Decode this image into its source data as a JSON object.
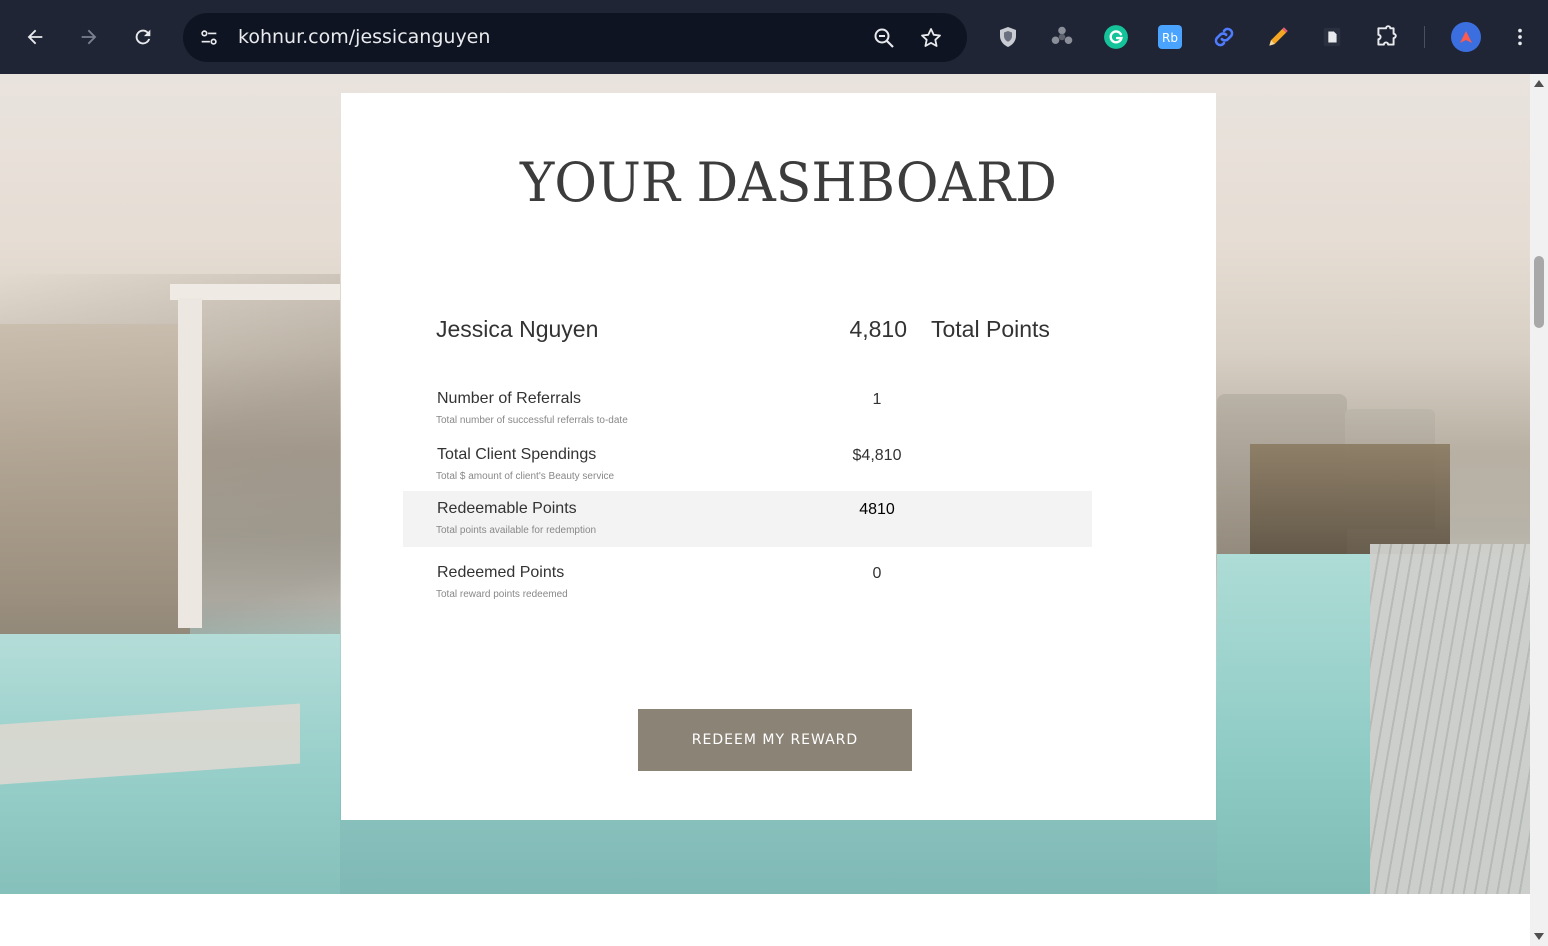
{
  "browser": {
    "url": "kohnur.com/jessicanguyen",
    "icons": {
      "back": "arrow-left-icon",
      "forward": "arrow-right-icon",
      "reload": "reload-icon",
      "site_info": "tune-icon",
      "zoom": "zoom-out-icon",
      "bookmark": "star-icon",
      "menu": "kebab-menu-icon"
    },
    "extensions": [
      {
        "name": "shield-extension-icon"
      },
      {
        "name": "cloud-extension-icon"
      },
      {
        "name": "grammarly-extension-icon"
      },
      {
        "name": "rb-extension-icon",
        "label": "Rb"
      },
      {
        "name": "link-extension-icon"
      },
      {
        "name": "pencil-extension-icon"
      },
      {
        "name": "document-extension-icon"
      },
      {
        "name": "puzzle-extensions-icon"
      },
      {
        "name": "profile-avatar-icon"
      }
    ],
    "colors": {
      "toolbar": "#1f2535",
      "omnibox": "#0f1422"
    }
  },
  "dashboard": {
    "title": "YOUR DASHBOARD",
    "user_name": "Jessica Nguyen",
    "total_points_value": "4,810",
    "total_points_label": "Total Points",
    "rows": [
      {
        "label": "Number of Referrals",
        "sublabel": "Total number of successful referrals to-date",
        "value": "1",
        "highlight": false
      },
      {
        "label": "Total Client Spendings",
        "sublabel": "Total $ amount of client's Beauty service",
        "value": "$4,810",
        "highlight": false
      },
      {
        "label": "Redeemable Points",
        "sublabel": "Total points available for redemption",
        "value": "4810",
        "highlight": true
      },
      {
        "label": "Redeemed Points",
        "sublabel": "Total reward points redeemed",
        "value": "0",
        "highlight": false
      }
    ],
    "redeem_button": "REDEEM MY REWARD",
    "colors": {
      "button": "#8c8377",
      "highlight_row": "#f3f3f3"
    }
  }
}
